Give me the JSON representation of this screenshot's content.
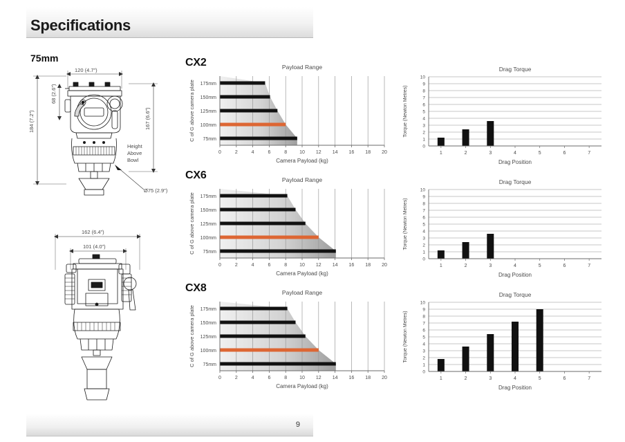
{
  "header": {
    "title": "Specifications"
  },
  "footer": {
    "page_number": "9"
  },
  "drawings": {
    "bowl_size_label": "75mm",
    "top_view": {
      "dims": [
        {
          "name": "width",
          "text": "120 (4.7\")"
        },
        {
          "name": "upper-height",
          "text": "68 (2.6\")"
        },
        {
          "name": "overall-height",
          "text": "184 (7.2\")"
        },
        {
          "name": "height-above-bowl",
          "text": "167 (6.6\")"
        },
        {
          "name": "bowl-diameter",
          "text": "Ø75 (2.9\")"
        }
      ],
      "note_lines": [
        "Height",
        "Above",
        "Bowl"
      ]
    },
    "bottom_view": {
      "dims": [
        {
          "name": "outer-width",
          "text": "162 (6.4\")"
        },
        {
          "name": "inner-width",
          "text": "101 (4.0\")"
        }
      ]
    }
  },
  "colors": {
    "payload_highlight": "#DD6633",
    "bar_black": "#111111",
    "grid": "#9a9a9a",
    "shade_light": "#f0f0f0",
    "shade_dark": "#9e9e9e"
  },
  "models": [
    {
      "name": "CX2",
      "payload": {
        "type": "bar",
        "title": "Payload Range",
        "xlabel": "Camera Payload (kg)",
        "ylabel": "C of G above camera plate",
        "xlim": [
          0,
          20
        ],
        "xticks": [
          0,
          2,
          4,
          6,
          8,
          10,
          12,
          14,
          16,
          18,
          20
        ],
        "categories": [
          "175mm",
          "150mm",
          "125mm",
          "100mm",
          "75mm"
        ],
        "values": [
          5.5,
          6.1,
          7.0,
          8.0,
          9.4
        ],
        "highlight_category": "100mm",
        "grid": true
      },
      "torque": {
        "type": "bar",
        "title": "Drag Torque",
        "xlabel": "Drag Position",
        "ylabel": "Torque (Newton Metres)",
        "ylim": [
          0,
          10
        ],
        "yticks": [
          0,
          1,
          2,
          3,
          4,
          5,
          6,
          7,
          8,
          9,
          10
        ],
        "categories": [
          "1",
          "2",
          "3",
          "4",
          "5",
          "6",
          "7"
        ],
        "values": [
          1.2,
          2.4,
          3.6,
          0,
          0,
          0,
          0
        ],
        "grid": true
      }
    },
    {
      "name": "CX6",
      "payload": {
        "type": "bar",
        "title": "Payload Range",
        "xlabel": "Camera Payload (kg)",
        "ylabel": "C of G above camera plate",
        "xlim": [
          0,
          20
        ],
        "xticks": [
          0,
          2,
          4,
          6,
          8,
          10,
          12,
          14,
          16,
          18,
          20
        ],
        "categories": [
          "175mm",
          "150mm",
          "125mm",
          "100mm",
          "75mm"
        ],
        "values": [
          8.2,
          9.2,
          10.4,
          12.0,
          14.1
        ],
        "highlight_category": "100mm",
        "grid": true
      },
      "torque": {
        "type": "bar",
        "title": "Drag Torque",
        "xlabel": "Drag Position",
        "ylabel": "Torque (Newton Metres)",
        "ylim": [
          0,
          10
        ],
        "yticks": [
          0,
          1,
          2,
          3,
          4,
          5,
          6,
          7,
          8,
          9,
          10
        ],
        "categories": [
          "1",
          "2",
          "3",
          "4",
          "5",
          "6",
          "7"
        ],
        "values": [
          1.2,
          2.4,
          3.6,
          0,
          0,
          0,
          0
        ],
        "grid": true
      }
    },
    {
      "name": "CX8",
      "payload": {
        "type": "bar",
        "title": "Payload Range",
        "xlabel": "Camera Payload (kg)",
        "ylabel": "C of G above camera plate",
        "xlim": [
          0,
          20
        ],
        "xticks": [
          0,
          2,
          4,
          6,
          8,
          10,
          12,
          14,
          16,
          18,
          20
        ],
        "categories": [
          "175mm",
          "150mm",
          "125mm",
          "100mm",
          "75mm"
        ],
        "values": [
          8.2,
          9.2,
          10.4,
          12.0,
          14.1
        ],
        "highlight_category": "100mm",
        "grid": true
      },
      "torque": {
        "type": "bar",
        "title": "Drag Torque",
        "xlabel": "Drag Position",
        "ylabel": "Torque (Newton Metres)",
        "ylim": [
          0,
          10
        ],
        "yticks": [
          0,
          1,
          2,
          3,
          4,
          5,
          6,
          7,
          8,
          9,
          10
        ],
        "categories": [
          "1",
          "2",
          "3",
          "4",
          "5",
          "6",
          "7"
        ],
        "values": [
          1.8,
          3.6,
          5.4,
          7.2,
          9.0,
          0,
          0
        ],
        "grid": true
      }
    }
  ]
}
